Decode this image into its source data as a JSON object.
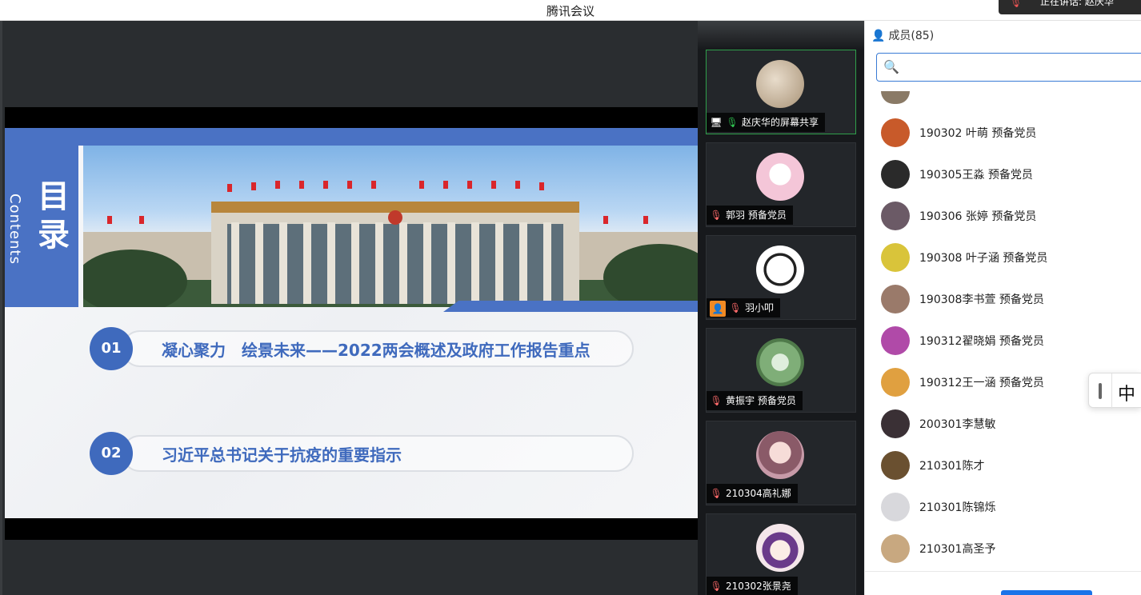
{
  "window": {
    "title": "腾讯会议",
    "speaking_text": "正在讲话: 赵庆华"
  },
  "slide": {
    "contents_cn": "目录",
    "contents_en": "Contents",
    "agenda": [
      {
        "num": "01",
        "label": "凝心聚力　绘景未来——2022两会概述及政府工作报告重点"
      },
      {
        "num": "02",
        "label": "习近平总书记关于抗疫的重要指示"
      }
    ]
  },
  "thumbnails": [
    {
      "name": "赵庆华的屏幕共享",
      "status": "screen-share",
      "avatar_color": "#c9b8a0"
    },
    {
      "name": "郭羽 预备党员",
      "status": "muted",
      "avatar_color": "#f4c6d8"
    },
    {
      "name": "羽小叩",
      "status": "muted-user",
      "avatar_color": "#f2f2f2"
    },
    {
      "name": "黄振宇 预备党员",
      "status": "muted",
      "avatar_color": "#9fc79a"
    },
    {
      "name": "210304高礼娜",
      "status": "muted",
      "avatar_color": "#c79aa8"
    },
    {
      "name": "210302张景尧",
      "status": "muted",
      "avatar_color": "#f4e6ea"
    }
  ],
  "panel": {
    "header": "成员(85)",
    "search_placeholder": "",
    "members": [
      {
        "name": "190302 叶萌 预备党员",
        "color": "#c85a2a"
      },
      {
        "name": "190305王淼 预备党员",
        "color": "#2a2a2a"
      },
      {
        "name": "190306 张婷 预备党员",
        "color": "#6b5a66"
      },
      {
        "name": "190308 叶子涵 预备党员",
        "color": "#d9c43a"
      },
      {
        "name": "190308李书萱 预备党员",
        "color": "#9a7a6a"
      },
      {
        "name": "190312翟晓娟 预备党员",
        "color": "#b04aa8"
      },
      {
        "name": "190312王一涵 预备党员",
        "color": "#e0a040"
      },
      {
        "name": "200301李慧敏",
        "color": "#3a3035"
      },
      {
        "name": "210301陈才",
        "color": "#6a5030"
      },
      {
        "name": "210301陈锦烁",
        "color": "#d8d8dc"
      },
      {
        "name": "210301高圣予",
        "color": "#c8a880"
      }
    ]
  },
  "ime": {
    "char": "中"
  }
}
